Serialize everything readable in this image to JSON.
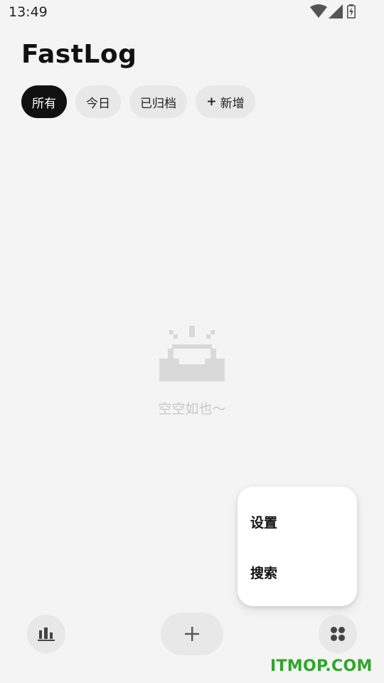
{
  "status_bar": {
    "time": "13:49",
    "icons": [
      "wifi-icon",
      "signal-icon",
      "battery-charging-icon"
    ]
  },
  "header": {
    "title": "FastLog"
  },
  "filters": {
    "items": [
      {
        "label": "所有",
        "active": true
      },
      {
        "label": "今日",
        "active": false
      },
      {
        "label": "已归档",
        "active": false
      }
    ],
    "add_plus": "+",
    "add_label": "新增"
  },
  "empty_state": {
    "icon": "empty-inbox-icon",
    "text": "空空如也～"
  },
  "popup_menu": {
    "items": [
      {
        "label": "设置"
      },
      {
        "label": "搜索"
      }
    ]
  },
  "bottom_bar": {
    "stats_icon": "bar-chart-icon",
    "add_icon": "plus-icon",
    "more_icon": "four-dots-icon"
  },
  "watermark": {
    "text": "ITMOP.COM"
  },
  "colors": {
    "background": "#f4f4f4",
    "chip_active": "#111111",
    "chip_inactive": "#e8e8e8",
    "watermark": "#2fa52c"
  }
}
